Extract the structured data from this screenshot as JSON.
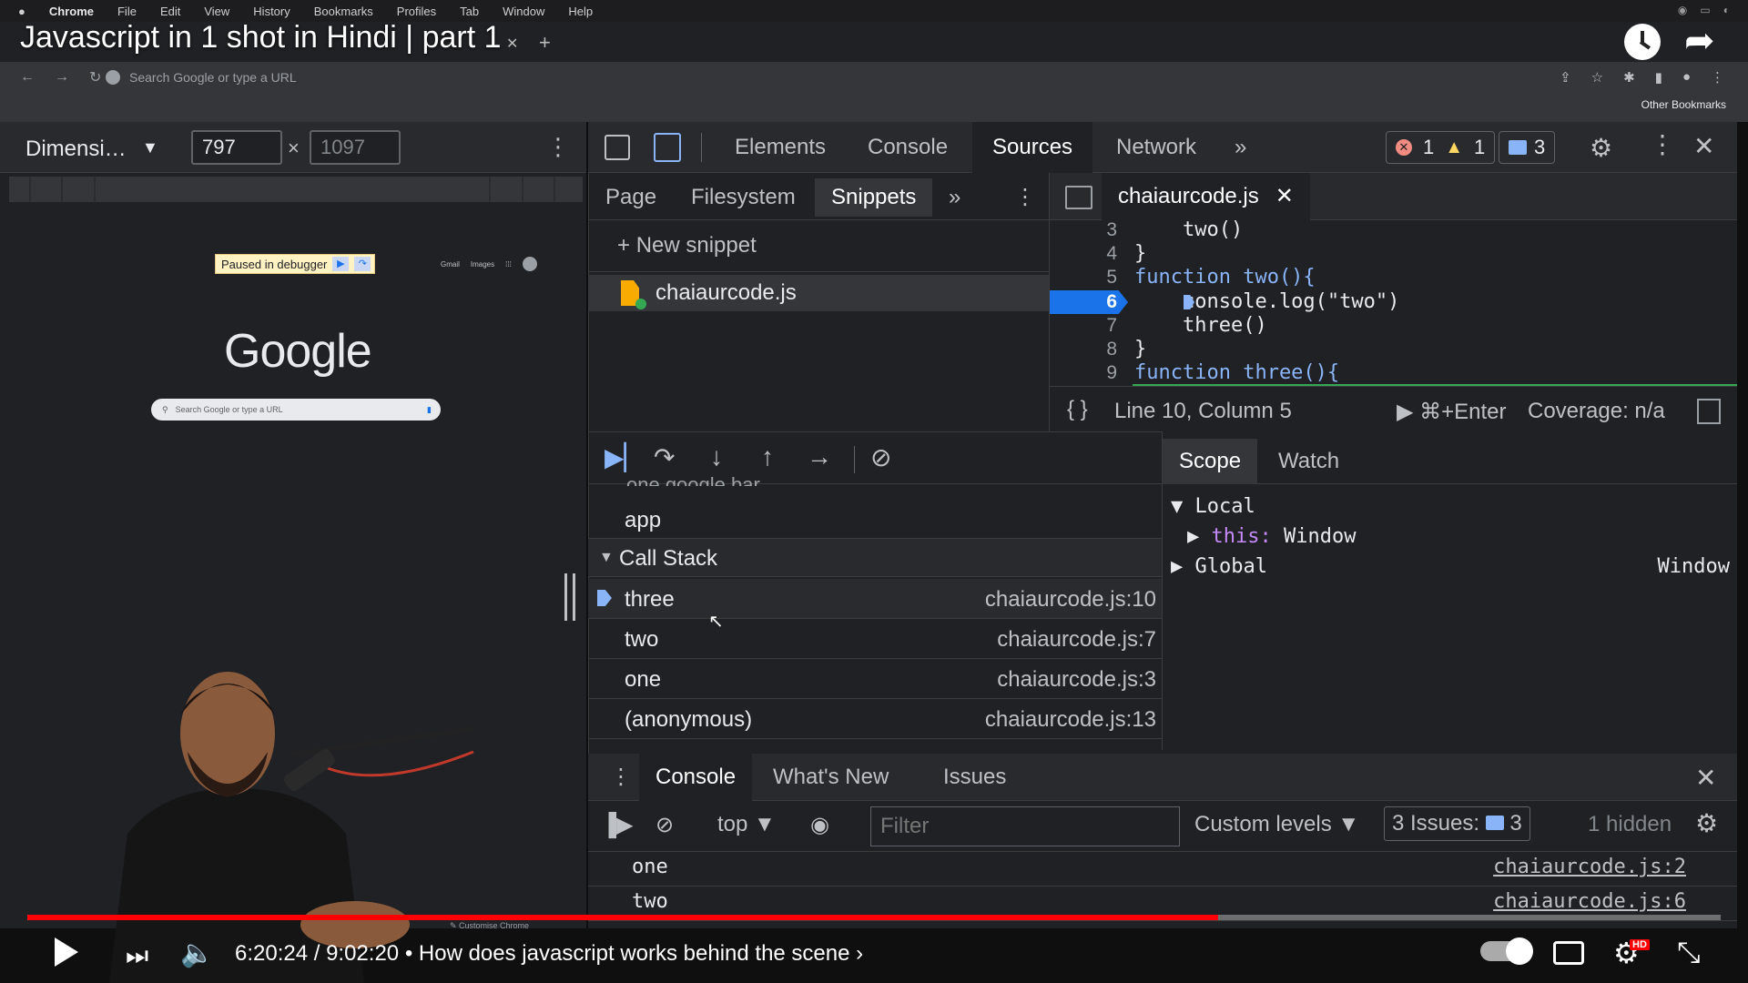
{
  "mac_menu": {
    "items": [
      "Chrome",
      "File",
      "Edit",
      "View",
      "History",
      "Bookmarks",
      "Profiles",
      "Tab",
      "Window",
      "Help"
    ]
  },
  "video": {
    "title": "Javascript in 1 shot in Hindi | part 1",
    "time": "6:20:24 / 9:02:20",
    "chapter": "• How does javascript works behind the scene ›",
    "progress": 0.703
  },
  "browser": {
    "omnibox_placeholder": "Search Google or type a URL",
    "other_bookmarks": "Other Bookmarks"
  },
  "device_toolbar": {
    "dimensions_label": "Dimensi…",
    "width": "797",
    "height": "1097",
    "times": "×"
  },
  "emulated_page": {
    "paused_text": "Paused in debugger",
    "links": [
      "Gmail",
      "Images"
    ],
    "logo": "Google",
    "search_placeholder": "Search Google or type a URL",
    "customise": "✎ Customise Chrome"
  },
  "devtools": {
    "tabs": [
      "Elements",
      "Console",
      "Sources",
      "Network"
    ],
    "active_tab": "Sources",
    "error_count": "1",
    "warning_count": "1",
    "message_count": "3",
    "navigator_tabs": [
      "Page",
      "Filesystem",
      "Snippets"
    ],
    "new_snippet": "New snippet",
    "snippet_file": "chaiaurcode.js",
    "editor_tab": "chaiaurcode.js",
    "code_lines": [
      {
        "n": "3",
        "text": "    two()"
      },
      {
        "n": "4",
        "text": "}"
      },
      {
        "n": "5",
        "text": "function two(){"
      },
      {
        "n": "6",
        "text": "    console.log(\"two\")"
      },
      {
        "n": "7",
        "text": "    three()"
      },
      {
        "n": "8",
        "text": "}"
      },
      {
        "n": "9",
        "text": "function three(){"
      }
    ],
    "cursor_position": "Line 10, Column 5",
    "run_hint": "⌘+Enter",
    "coverage": "Coverage: n/a",
    "above_call_stack": "one google bar",
    "app_row": "app",
    "call_stack_title": "Call Stack",
    "call_stack": [
      {
        "name": "three",
        "loc": "chaiaurcode.js:10"
      },
      {
        "name": "two",
        "loc": "chaiaurcode.js:7"
      },
      {
        "name": "one",
        "loc": "chaiaurcode.js:3"
      },
      {
        "name": "(anonymous)",
        "loc": "chaiaurcode.js:13"
      }
    ],
    "scope_tabs": [
      "Scope",
      "Watch"
    ],
    "scope": {
      "local": "Local",
      "this_key": "this:",
      "this_val": "Window",
      "global": "Global",
      "global_val": "Window"
    },
    "drawer_tabs": [
      "Console",
      "What's New",
      "Issues"
    ],
    "console_context": "top",
    "filter_placeholder": "Filter",
    "custom_levels": "Custom levels ▼",
    "issues_label": "3 Issues:",
    "issues_count": "3",
    "hidden": "1 hidden",
    "logs": [
      {
        "msg": "one",
        "src": "chaiaurcode.js:2"
      },
      {
        "msg": "two",
        "src": "chaiaurcode.js:6"
      }
    ]
  }
}
